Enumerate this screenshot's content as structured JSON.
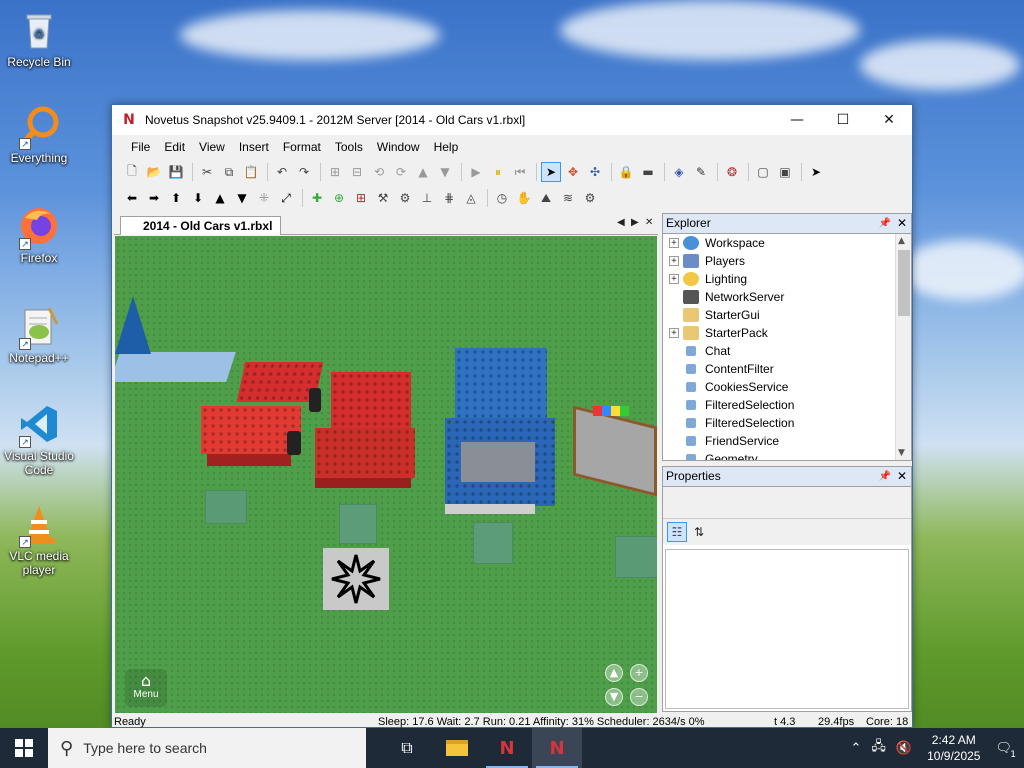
{
  "desktop": {
    "icons": [
      {
        "label": "Recycle Bin"
      },
      {
        "label": "Everything"
      },
      {
        "label": "Firefox"
      },
      {
        "label": "Notepad++"
      },
      {
        "label": "Visual Studio Code"
      },
      {
        "label": "VLC media player"
      }
    ]
  },
  "window": {
    "title": "Novetus Snapshot v25.9409.1 - 2012M Server [2014 - Old Cars v1.rbxl]",
    "app_icon": "N",
    "menu": [
      "File",
      "Edit",
      "View",
      "Insert",
      "Format",
      "Tools",
      "Window",
      "Help"
    ],
    "doc_tab": "2014 - Old Cars v1.rbxl",
    "viewport_menu_label": "Menu"
  },
  "explorer": {
    "title": "Explorer",
    "items": [
      {
        "label": "Workspace",
        "expandable": true,
        "icon_color": "#4a90d9"
      },
      {
        "label": "Players",
        "expandable": true,
        "icon_color": "#6b8cc7"
      },
      {
        "label": "Lighting",
        "expandable": true,
        "icon_color": "#f2c744"
      },
      {
        "label": "NetworkServer",
        "expandable": false,
        "icon_color": "#555555"
      },
      {
        "label": "StarterGui",
        "expandable": false,
        "icon_color": "#e8c872"
      },
      {
        "label": "StarterPack",
        "expandable": true,
        "icon_color": "#e8c872"
      },
      {
        "label": "Chat",
        "expandable": false,
        "icon_color": "#7fa8d8"
      },
      {
        "label": "ContentFilter",
        "expandable": false,
        "icon_color": "#7fa8d8"
      },
      {
        "label": "CookiesService",
        "expandable": false,
        "icon_color": "#7fa8d8"
      },
      {
        "label": "FilteredSelection",
        "expandable": false,
        "icon_color": "#7fa8d8"
      },
      {
        "label": "FilteredSelection",
        "expandable": false,
        "icon_color": "#7fa8d8"
      },
      {
        "label": "FriendService",
        "expandable": false,
        "icon_color": "#7fa8d8"
      },
      {
        "label": "Geometry",
        "expandable": false,
        "icon_color": "#7fa8d8"
      }
    ]
  },
  "properties": {
    "title": "Properties"
  },
  "status": {
    "ready": "Ready",
    "stats": "Sleep: 17.6 Wait: 2.7 Run: 0.21 Affinity: 31% Scheduler: 2634/s 0%",
    "t": "t 4.3",
    "fps": "29.4fps",
    "cores": "Core: 18"
  },
  "taskbar": {
    "search_placeholder": "Type here to search",
    "time": "2:42 AM",
    "date": "10/9/2025",
    "notifications": "1"
  }
}
